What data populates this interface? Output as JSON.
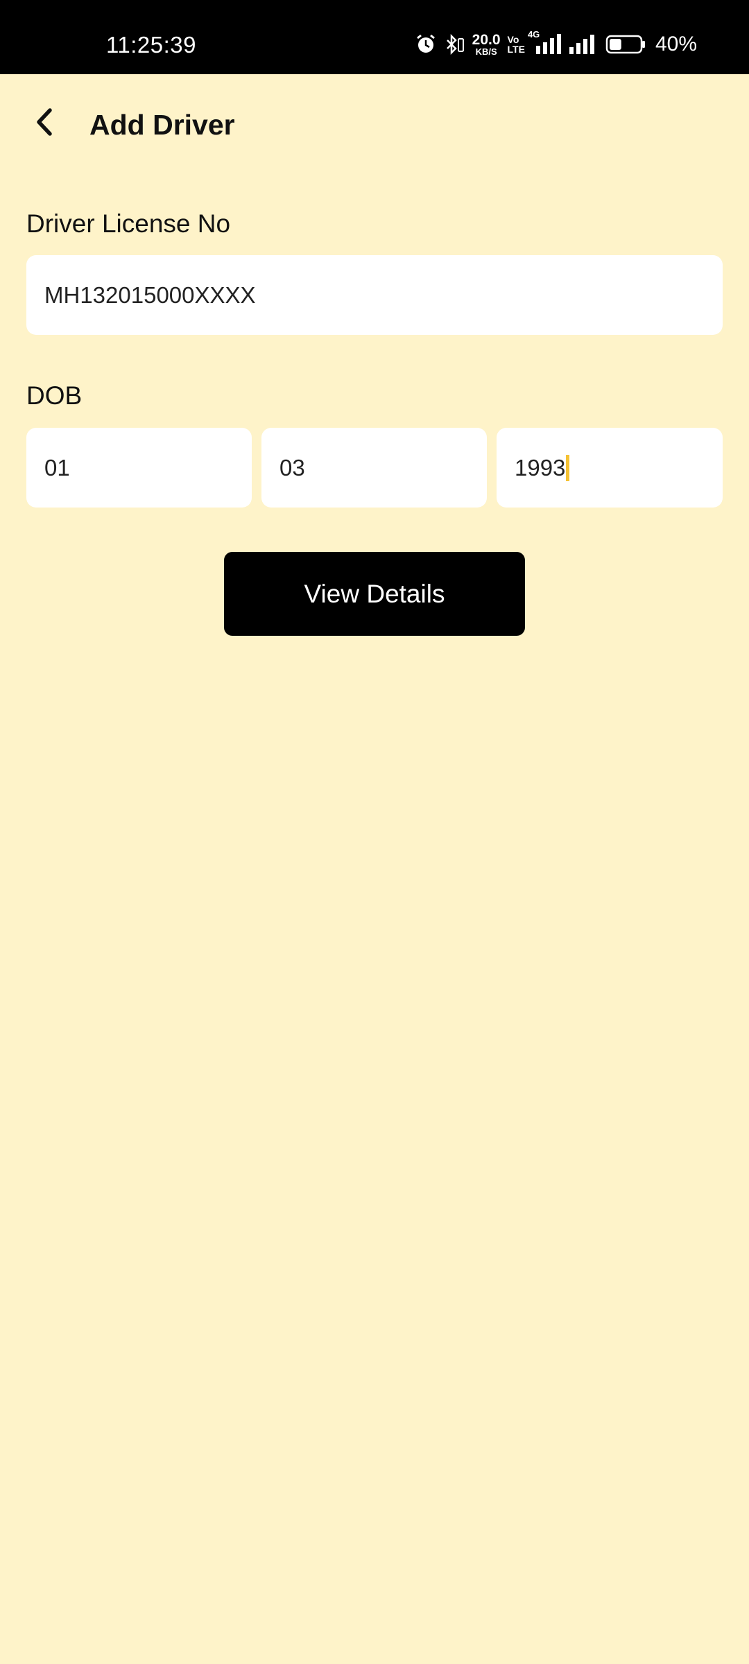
{
  "status_bar": {
    "time": "11:25:39",
    "net_speed_value": "20.0",
    "net_speed_unit": "KB/S",
    "volte_top": "Vo",
    "volte_bottom": "LTE",
    "network_type": "4G",
    "battery_percent": "40%",
    "battery_level": 0.4
  },
  "header": {
    "title": "Add Driver"
  },
  "form": {
    "license_label": "Driver License No",
    "license_value": "MH132015000XXXX",
    "dob_label": "DOB",
    "dob_day": "01",
    "dob_month": "03",
    "dob_year": "1993"
  },
  "actions": {
    "view_details_label": "View Details"
  },
  "colors": {
    "background": "#fef3c9",
    "caret": "#f5c234",
    "button": "#000000"
  }
}
